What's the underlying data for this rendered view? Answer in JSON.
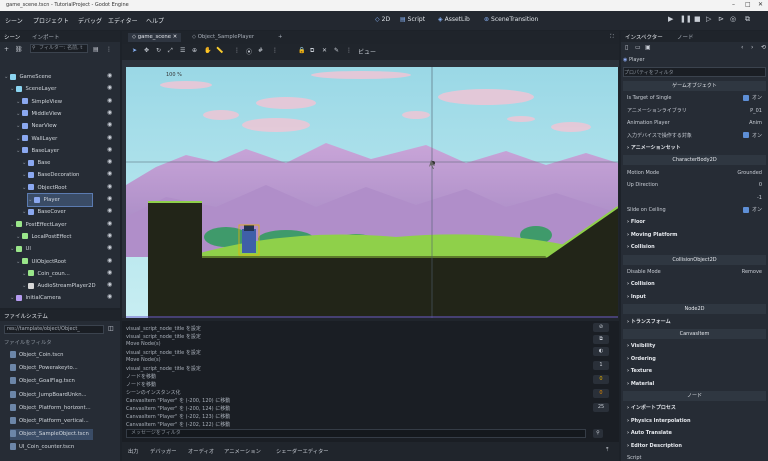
{
  "titlebar": {
    "title": "game_scene.tscn - TutorialProject - Godot Engine"
  },
  "menu": {
    "items": [
      "シーン",
      "プロジェクト",
      "デバッグ",
      "エディター",
      "ヘルプ"
    ]
  },
  "workspaces": [
    {
      "label": "2D",
      "icon": "2d-icon"
    },
    {
      "label": "Script",
      "icon": "script-icon"
    },
    {
      "label": "AssetLib",
      "icon": "assetlib-icon"
    },
    {
      "label": "SceneTransition",
      "icon": "scene-transition-icon"
    }
  ],
  "scene_dock": {
    "tabs": [
      "シーン",
      "インポート"
    ],
    "filter_placeholder": "フィルター: 名前, t",
    "tree": [
      {
        "label": "GameScene",
        "color": "#8bd4f0"
      },
      {
        "label": "SceneLayer",
        "color": "#8bd4f0"
      },
      {
        "label": "SimpleView",
        "color": "#8ba8f0"
      },
      {
        "label": "MiddleView",
        "color": "#8ba8f0"
      },
      {
        "label": "NearView",
        "color": "#8ba8f0"
      },
      {
        "label": "WallLayer",
        "color": "#8ba8f0"
      },
      {
        "label": "BaseLayer",
        "color": "#8ba8f0"
      },
      {
        "label": "Base",
        "color": "#8ba8f0"
      },
      {
        "label": "BaseDecoration",
        "color": "#8ba8f0"
      },
      {
        "label": "ObjectRoot",
        "color": "#8ba8f0"
      },
      {
        "label": "Player",
        "color": "#8ba8f0"
      },
      {
        "label": "BaseCover",
        "color": "#8ba8f0"
      },
      {
        "label": "PostEffectLayer",
        "color": "#9ae68a"
      },
      {
        "label": "LocalPostEffect",
        "color": "#9ae68a"
      },
      {
        "label": "UI",
        "color": "#9ae68a"
      },
      {
        "label": "UIObjectRoot",
        "color": "#9ae68a"
      },
      {
        "label": "Coin_coun...",
        "color": "#9ae68a"
      },
      {
        "label": "AudioStreamPlayer2D",
        "color": "#d8d8d8"
      },
      {
        "label": "InitialCamera",
        "color": "#b59bf0"
      }
    ]
  },
  "fs_dock": {
    "tab": "ファイルシステム",
    "path": "res://tamplate/object/Object_",
    "filter_placeholder": "ファイルをフィルタ",
    "files": [
      "Object_Coin.tscn",
      "Object_Powerakeyto...",
      "Object_GoalFlag.tscn",
      "Object_JumpBoardUnkn...",
      "Object_Platform_horizont...",
      "Object_Platform_vertical...",
      "Object_SampleObject.tscn",
      "UI_Coin_counter.tscn"
    ]
  },
  "editor": {
    "tabs": [
      "game_scene",
      "Object_SamplePlayer"
    ],
    "view_label": "ビュー",
    "zoom": "100 %"
  },
  "output": {
    "lines": [
      "visual_script_node_title を設定",
      "visual_script_node_title を設定",
      "Move Node(s)",
      "visual_script_node_title を設定",
      "Move Node(s)",
      "visual_script_node_title を設定",
      "ノードを移動",
      "ノードを移動",
      "シーンのインスタンス化",
      "CanvasItem \"Player\" を (-200, 120) に移動",
      "CanvasItem \"Player\" を (-200, 124) に移動",
      "CanvasItem \"Player\" を (-202, 123) に移動",
      "CanvasItem \"Player\" を (-202, 122) に移動"
    ],
    "filter_placeholder": "メッセージをフィルタ",
    "counts": [
      "1",
      "0",
      "0",
      "25"
    ]
  },
  "bottom_tabs": [
    "出力",
    "デバッガー",
    "オーディオ",
    "アニメーション",
    "シェーダーエディター"
  ],
  "inspector": {
    "tabs": [
      "インスペクター",
      "ノード"
    ],
    "node_name": "Player",
    "filter_placeholder": "プロパティをフィルタ",
    "rows": [
      {
        "type": "head",
        "label": "ゲームオブジェクト"
      },
      {
        "type": "row",
        "label": "Is Target of Single",
        "value": "オン",
        "check": true
      },
      {
        "type": "row",
        "label": "アニメーションライブラリ",
        "value": "P_01"
      },
      {
        "type": "row",
        "label": "Animation Player",
        "value": "Anim"
      },
      {
        "type": "row",
        "label": "入力デバイスで操作する対象",
        "value": "オン",
        "check": true
      },
      {
        "type": "sec",
        "label": "アニメーションセット"
      },
      {
        "type": "head",
        "label": "CharacterBody2D"
      },
      {
        "type": "row",
        "label": "Motion Mode",
        "value": "Grounded"
      },
      {
        "type": "row",
        "label": "Up Direction",
        "value": "0"
      },
      {
        "type": "row",
        "label": "",
        "value": "-1"
      },
      {
        "type": "row",
        "label": "Slide on Ceiling",
        "value": "オン",
        "check": true
      },
      {
        "type": "sec",
        "label": "Floor"
      },
      {
        "type": "sec",
        "label": "Moving Platform"
      },
      {
        "type": "sec",
        "label": "Collision"
      },
      {
        "type": "head",
        "label": "CollisionObject2D"
      },
      {
        "type": "row",
        "label": "Disable Mode",
        "value": "Remove"
      },
      {
        "type": "sec",
        "label": "Collision"
      },
      {
        "type": "sec",
        "label": "Input"
      },
      {
        "type": "head",
        "label": "Node2D"
      },
      {
        "type": "sec",
        "label": "トランスフォーム"
      },
      {
        "type": "head",
        "label": "CanvasItem"
      },
      {
        "type": "sec",
        "label": "Visibility"
      },
      {
        "type": "sec",
        "label": "Ordering"
      },
      {
        "type": "sec",
        "label": "Texture"
      },
      {
        "type": "sec",
        "label": "Material"
      },
      {
        "type": "head",
        "label": "ノード"
      },
      {
        "type": "sec",
        "label": "インポートプロセス"
      },
      {
        "type": "sec",
        "label": "Physics Interpolation"
      },
      {
        "type": "sec",
        "label": "Auto Translate"
      },
      {
        "type": "sec",
        "label": "Editor Description"
      },
      {
        "type": "row",
        "label": "Script",
        "value": ""
      }
    ]
  },
  "colors": {
    "accent": "#5e8fd6",
    "sky": "#8fd5e8",
    "mountain": "#b78cc9",
    "grass": "#8fd04a",
    "ground": "#222518"
  }
}
